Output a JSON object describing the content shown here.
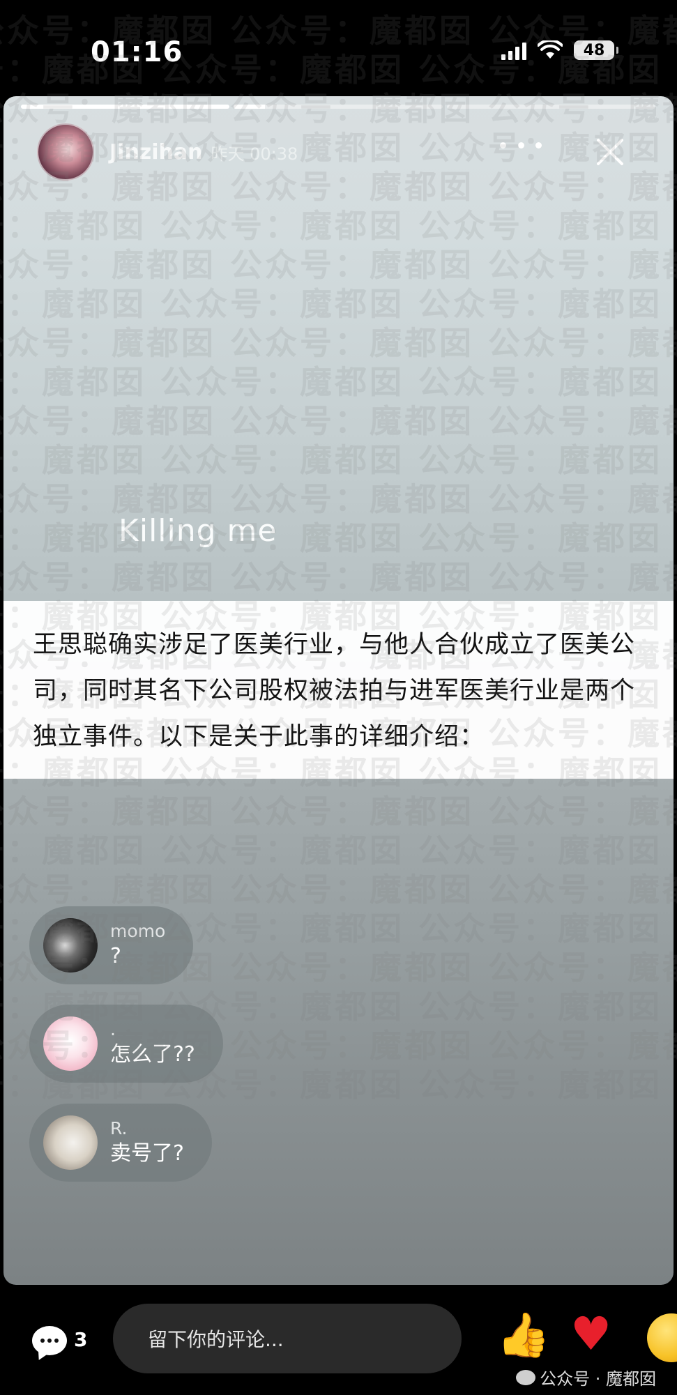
{
  "status_bar": {
    "time": "01:16",
    "battery": "48",
    "icons": [
      "signal-icon",
      "wifi-icon",
      "battery-icon"
    ]
  },
  "story": {
    "progress_segments": [
      1.0,
      0.15,
      0.0
    ],
    "username": "Jinzihan",
    "post_time": "昨天 00:38",
    "song_text": "Killing me",
    "info_text": "王思聪确实涉足了医美行业，与他人合伙成立了医美公司，同时其名下公司股权被法拍与进军医美行业是两个独立事件。以下是关于此事的详细介绍：",
    "colors": {
      "card_top": "#d9dfe1",
      "card_bottom": "#7c8284",
      "band": "#ffffff"
    }
  },
  "comments": [
    {
      "name": "momo",
      "text": "?",
      "avatar": "dark-photo-avatar"
    },
    {
      "name": ".",
      "text": "怎么了??",
      "avatar": "hello-kitty-avatar"
    },
    {
      "name": "R.",
      "text": "卖号了?",
      "avatar": "girl-photo-avatar"
    }
  ],
  "bottom_bar": {
    "comment_count": "3",
    "input_placeholder": "留下你的评论...",
    "reactions": [
      "thumbs-up-icon",
      "heart-icon",
      "laughing-emoji-icon"
    ],
    "source_label": "公众号 · 魔都囡"
  },
  "watermark": {
    "text": "公众号：魔都囡"
  }
}
